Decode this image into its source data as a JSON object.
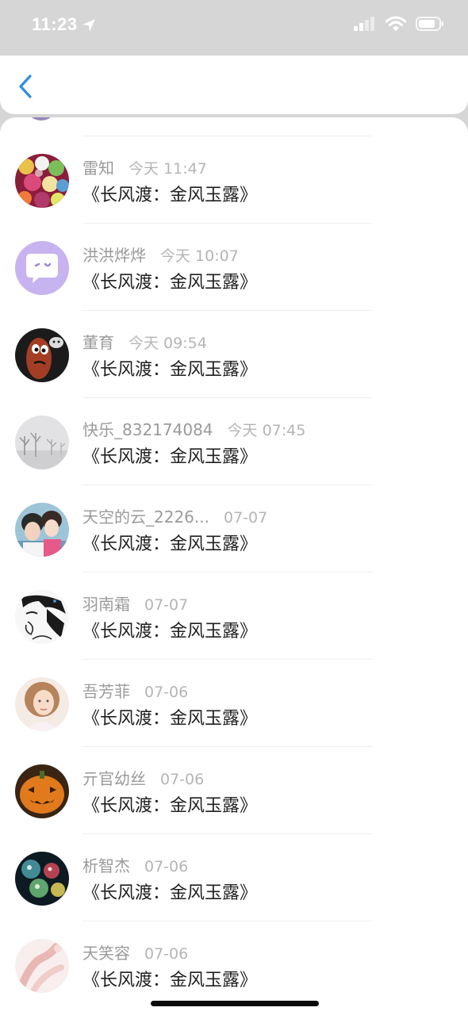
{
  "status_bar": {
    "time": "11:23"
  },
  "header": {
    "back_icon": "chevron-left-icon",
    "accent_color": "#2a8fe5"
  },
  "comments": [
    {
      "name": "雷知",
      "time": "今天 11:47",
      "message": "《长风渡：金风玉露》",
      "avatar": "candy-avatar"
    },
    {
      "name": "洪洪烨烨",
      "time": "今天 10:07",
      "message": "《长风渡：金风玉露》",
      "avatar": "chat-bubble-avatar"
    },
    {
      "name": "董育",
      "time": "今天 09:54",
      "message": "《长风渡：金风玉露》",
      "avatar": "egg-face-avatar"
    },
    {
      "name": "快乐_832174084",
      "time": "今天 07:45",
      "message": "《长风渡：金风玉露》",
      "avatar": "foggy-trees-avatar"
    },
    {
      "name": "天空的云_2226...",
      "time": "07-07",
      "message": "《长风渡：金风玉露》",
      "avatar": "selfie-avatar"
    },
    {
      "name": "羽南霜",
      "time": "07-07",
      "message": "《长风渡：金风玉露》",
      "avatar": "sketch-face-avatar"
    },
    {
      "name": "吾芳菲",
      "time": "07-06",
      "message": "《长风渡：金风玉露》",
      "avatar": "portrait-avatar"
    },
    {
      "name": "亓官幼丝",
      "time": "07-06",
      "message": "《长风渡：金风玉露》",
      "avatar": "pumpkin-avatar"
    },
    {
      "name": "析智杰",
      "time": "07-06",
      "message": "《长风渡：金风玉露》",
      "avatar": "glass-jars-avatar"
    },
    {
      "name": "天笑容",
      "time": "07-06",
      "message": "《长风渡：金风玉露》",
      "avatar": "pastel-hands-avatar"
    }
  ]
}
